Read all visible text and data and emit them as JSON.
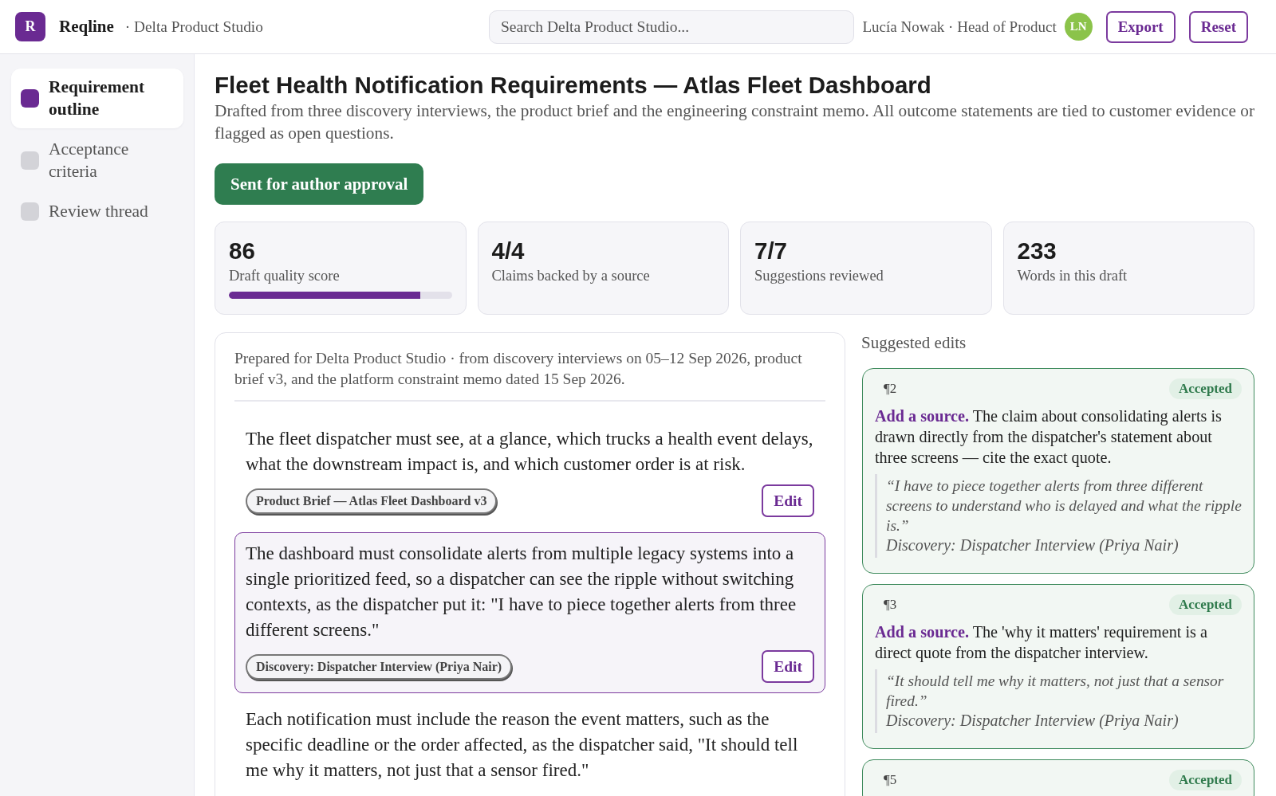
{
  "app": {
    "logo_letter": "R",
    "name": "Reqline",
    "workspace": "· Delta Product Studio"
  },
  "search": {
    "placeholder": "Search Delta Product Studio..."
  },
  "user": {
    "label": "Lucía Nowak · Head of Product",
    "initials": "LN"
  },
  "actions": [
    "Export",
    "Reset"
  ],
  "sidebar": {
    "items": [
      {
        "label": "Requirement outline",
        "selected": true
      },
      {
        "label": "Acceptance criteria",
        "selected": false
      },
      {
        "label": "Review thread",
        "selected": false
      }
    ]
  },
  "header": {
    "title": "Fleet Health Notification Requirements — Atlas Fleet Dashboard",
    "subtitle": "Drafted from three discovery interviews, the product brief and the engineering constraint memo. All outcome statements are tied to customer evidence or flagged as open questions.",
    "status_button": "Sent for author approval"
  },
  "stats": [
    {
      "value": "86",
      "label": "Draft quality score",
      "level": 0.86
    },
    {
      "value": "4/4",
      "label": "Claims backed by a source"
    },
    {
      "value": "7/7",
      "label": "Suggestions reviewed"
    },
    {
      "value": "233",
      "label": "Words in this draft"
    }
  ],
  "document": {
    "preamble": "Prepared for Delta Product Studio · from discovery interviews on 05–12 Sep 2026, product brief v3, and the platform constraint memo dated 15 Sep 2026.",
    "paragraphs": [
      {
        "text": "The fleet dispatcher must see, at a glance, which trucks a health event delays, what the downstream impact is, and which customer order is at risk.",
        "source": "Product Brief — Atlas Fleet Dashboard v3",
        "action": "Edit",
        "selected": false
      },
      {
        "text": "The dashboard must consolidate alerts from multiple legacy systems into a single prioritized feed, so a dispatcher can see the ripple without switching contexts, as the dispatcher put it: \"I have to piece together alerts from three different screens.\"",
        "source": "Discovery: Dispatcher Interview (Priya Nair)",
        "action": "Edit",
        "selected": true
      },
      {
        "text": "Each notification must include the reason the event matters, such as the specific deadline or the order affected, as the dispatcher said, \"It should tell me why it matters, not just that a sensor fired.\"",
        "selected": false
      }
    ]
  },
  "suggestions": {
    "title": "Suggested edits",
    "items": [
      {
        "paragraph": "¶2",
        "status": "Accepted",
        "kind": "accepted",
        "text": "**Add a source.** The claim about consolidating alerts is drawn directly from the dispatcher's statement about three screens — cite the exact quote.",
        "quote": "“I have to piece together alerts from three different screens to understand who is delayed and what the ripple is.”",
        "source": "Discovery: Dispatcher Interview (Priya Nair)"
      },
      {
        "paragraph": "¶3",
        "status": "Accepted",
        "kind": "accepted",
        "text": "**Add a source.** The 'why it matters' requirement is a direct quote from the dispatcher interview.",
        "quote": "“It should tell me why it matters, not just that a sensor fired.”",
        "source": "Discovery: Dispatcher Interview (Priya Nair)"
      },
      {
        "paragraph": "¶5",
        "status": "Accepted",
        "kind": "accepted"
      }
    ]
  }
}
